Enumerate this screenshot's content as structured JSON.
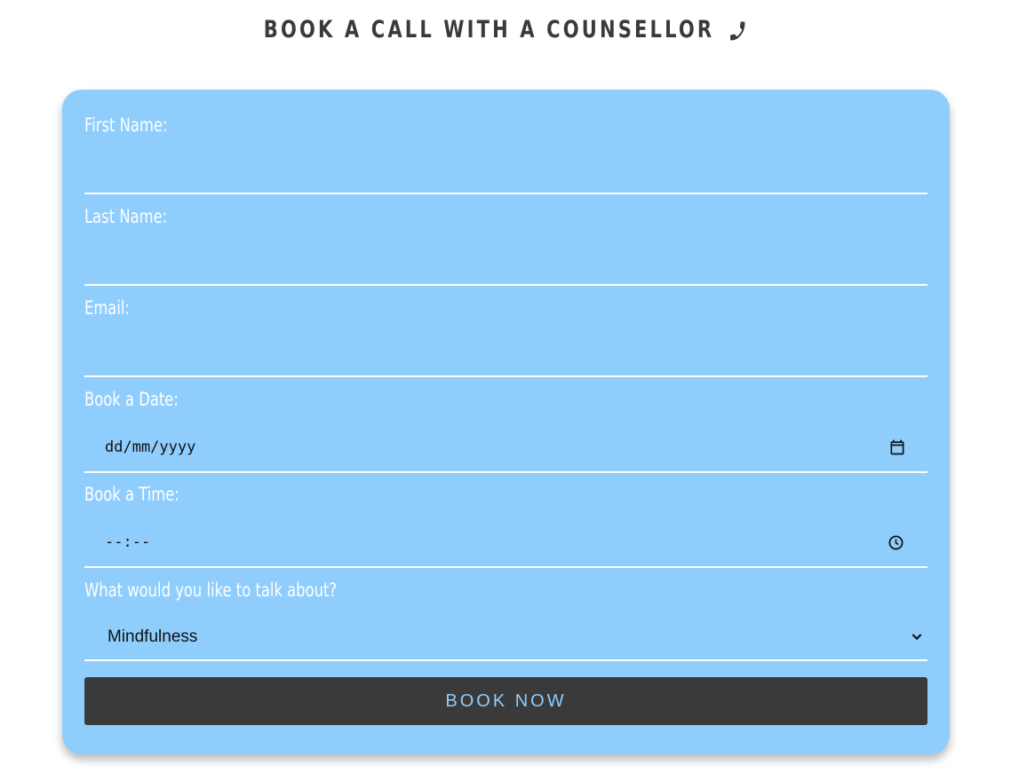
{
  "page": {
    "title": "BOOK A CALL WITH A COUNSELLOR",
    "title_icon": "phone-icon"
  },
  "form": {
    "background": "#8fcdfd",
    "first_name": {
      "label": "First Name:",
      "value": ""
    },
    "last_name": {
      "label": "Last Name:",
      "value": ""
    },
    "email": {
      "label": "Email:",
      "value": ""
    },
    "date": {
      "label": "Book a Date:",
      "placeholder": "dd/mm/yyyy",
      "icon": "calendar-icon"
    },
    "time": {
      "label": "Book a Time:",
      "placeholder": "--:--",
      "icon": "clock-icon"
    },
    "topic": {
      "label": "What would you like to talk about?",
      "selected": "Mindfulness",
      "icon": "chevron-down-icon"
    },
    "submit_label": "BOOK NOW",
    "submit_background": "#3a3a3a"
  }
}
